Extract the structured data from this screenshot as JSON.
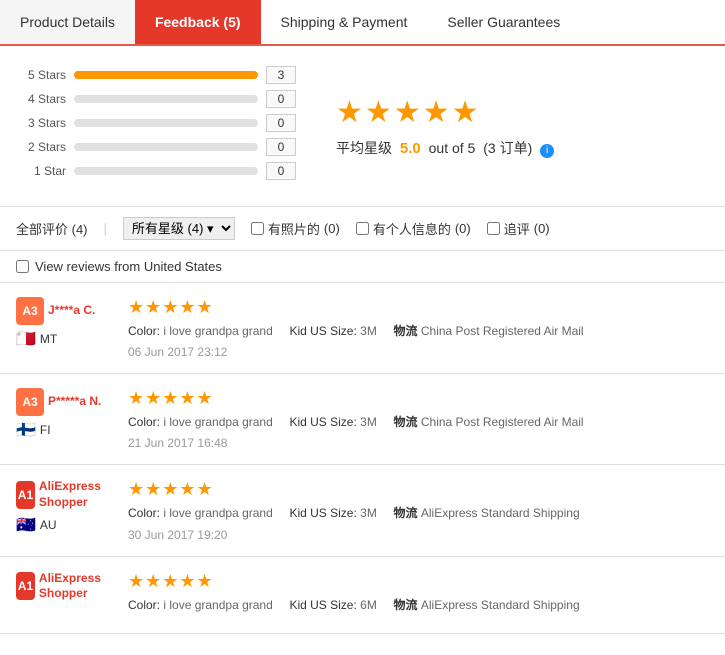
{
  "tabs": [
    {
      "id": "product-details",
      "label": "Product Details",
      "active": false
    },
    {
      "id": "feedback",
      "label": "Feedback (5)",
      "active": true
    },
    {
      "id": "shipping-payment",
      "label": "Shipping & Payment",
      "active": false
    },
    {
      "id": "seller-guarantees",
      "label": "Seller Guarantees",
      "active": false
    }
  ],
  "rating": {
    "stars": {
      "5": {
        "label": "5 Stars",
        "count": 3,
        "pct": 100
      },
      "4": {
        "label": "4 Stars",
        "count": 0,
        "pct": 0
      },
      "3": {
        "label": "3 Stars",
        "count": 0,
        "pct": 0
      },
      "2": {
        "label": "2 Stars",
        "count": 0,
        "pct": 0
      },
      "1": {
        "label": "1 Star",
        "count": 0,
        "pct": 0
      }
    },
    "average": "5.0 out of 5",
    "avg_num": "5.0",
    "avg_suffix": "out of 5",
    "order_count": "(3 订单)",
    "stars_display": "★★★★★",
    "avg_prefix": "平均星级"
  },
  "filters": {
    "all_label": "全部评价 (4)",
    "star_label": "所有星级 (4)",
    "with_photo_label": "有照片的",
    "with_photo_count": "(0)",
    "with_info_label": "有个人信息的",
    "with_info_count": "(0)",
    "follow_label": "追评",
    "follow_count": "(0)"
  },
  "view_us_label": "View reviews from United States",
  "reviews": [
    {
      "avatar_text": "A3",
      "avatar_class": "a3",
      "name": "J****a C.",
      "flag": "🇲🇹",
      "country": "MT",
      "stars": "★★★★★",
      "color_label": "Color:",
      "color_value": "i love grandpa grand",
      "size_label": "Kid US Size:",
      "size_value": "3M",
      "shipping_label": "物流",
      "shipping_value": "China Post Registered Air Mail",
      "date": "06 Jun 2017 23:12"
    },
    {
      "avatar_text": "A3",
      "avatar_class": "a3",
      "name": "P*****a N.",
      "flag": "🇫🇮",
      "country": "FI",
      "stars": "★★★★★",
      "color_label": "Color:",
      "color_value": "i love grandpa grand",
      "size_label": "Kid US Size:",
      "size_value": "3M",
      "shipping_label": "物流",
      "shipping_value": "China Post Registered Air Mail",
      "date": "21 Jun 2017 16:48"
    },
    {
      "avatar_text": "A1",
      "avatar_class": "a1",
      "name": "AliExpress Shopper",
      "flag": "🇦🇺",
      "country": "AU",
      "stars": "★★★★★",
      "color_label": "Color:",
      "color_value": "i love grandpa grand",
      "size_label": "Kid US Size:",
      "size_value": "3M",
      "shipping_label": "物流",
      "shipping_value": "AliExpress Standard Shipping",
      "date": "30 Jun 2017 19:20"
    },
    {
      "avatar_text": "A1",
      "avatar_class": "a1",
      "name": "AliExpress Shopper",
      "flag": "",
      "country": "",
      "stars": "★★★★★",
      "color_label": "Color:",
      "color_value": "i love grandpa grand",
      "size_label": "Kid US Size:",
      "size_value": "6M",
      "shipping_label": "物流",
      "shipping_value": "AliExpress Standard Shipping",
      "date": ""
    }
  ]
}
